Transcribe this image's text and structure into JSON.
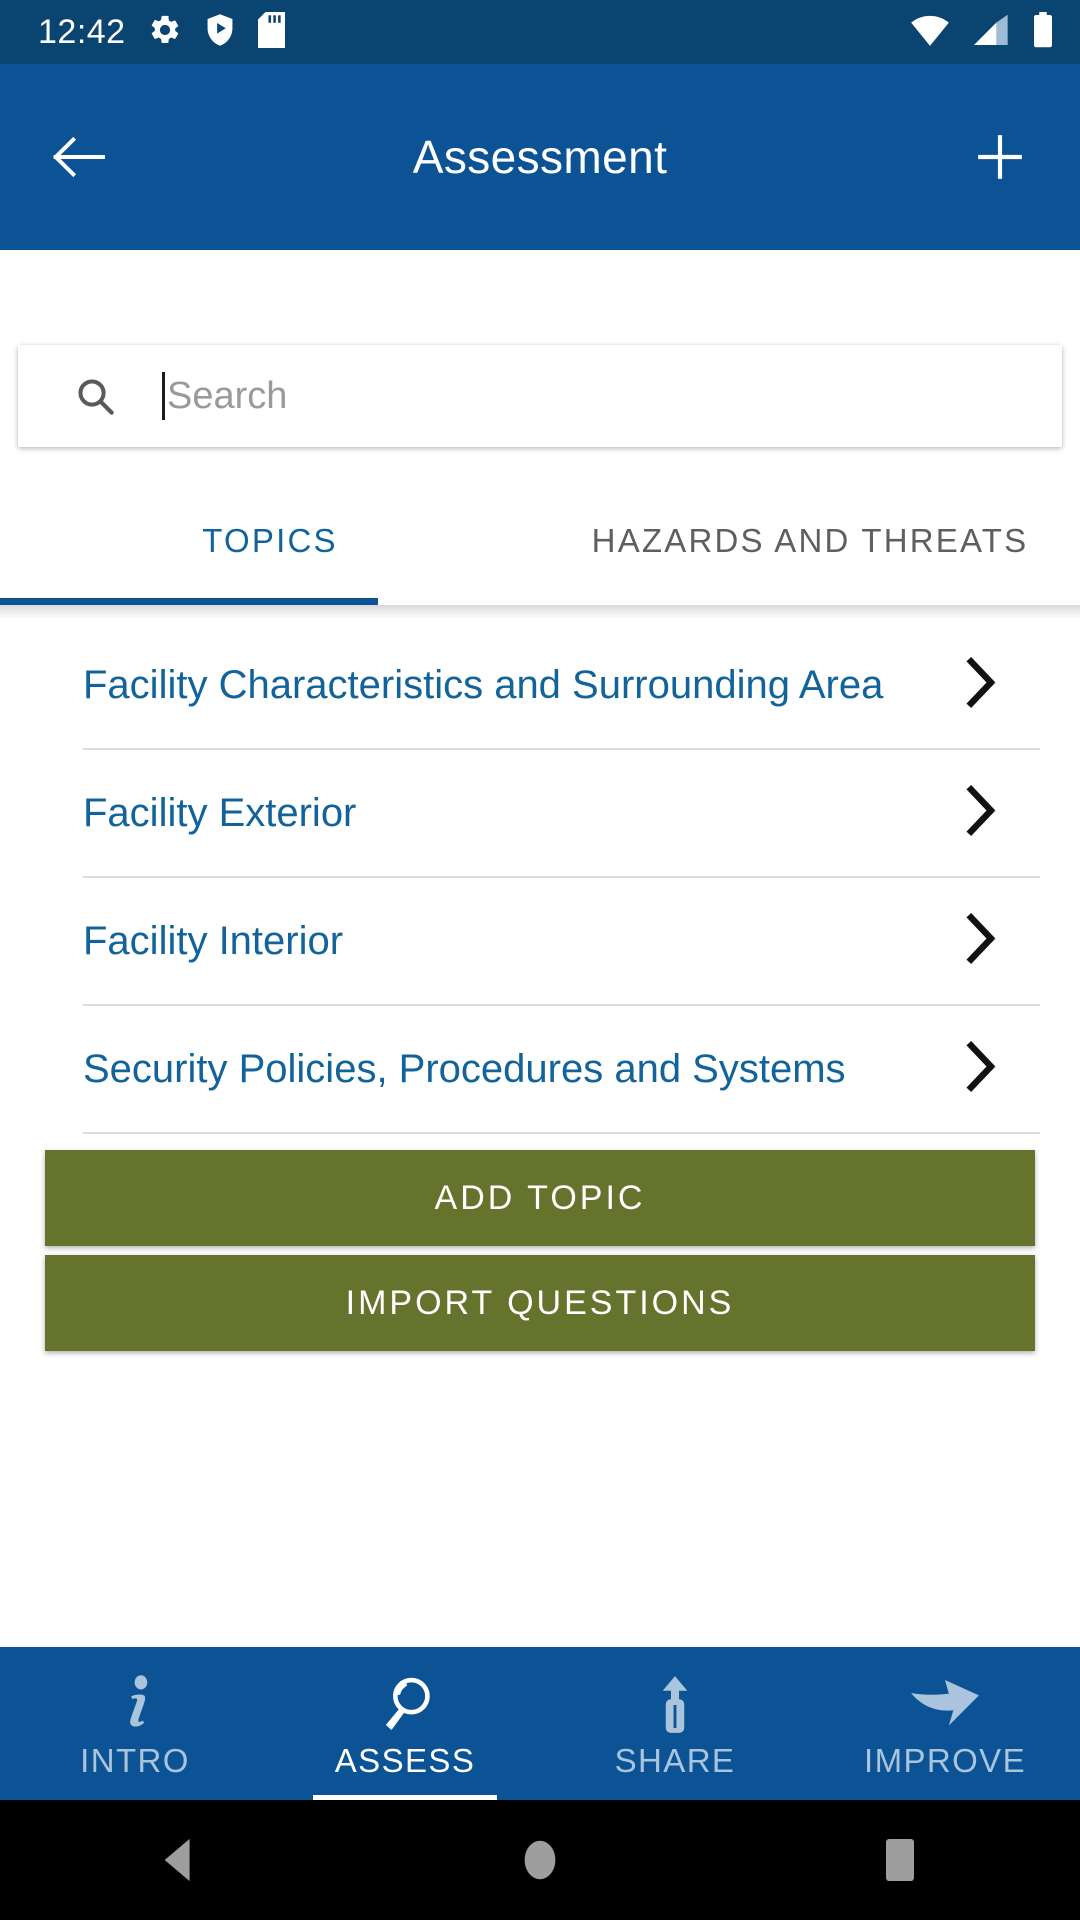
{
  "status_bar": {
    "time": "12:42",
    "left_icons": [
      "gear-icon",
      "play-protect-shield-icon",
      "sd-card-icon"
    ],
    "right_icons": [
      "wifi-icon",
      "cellular-signal-icon",
      "battery-icon"
    ],
    "background_color": "#0a4470"
  },
  "app_bar": {
    "title": "Assessment",
    "back_icon": "arrow-left-icon",
    "add_icon": "plus-icon",
    "background_color": "#0b5394"
  },
  "search": {
    "icon": "search-icon",
    "placeholder": "Search",
    "value": ""
  },
  "tabs": {
    "items": [
      {
        "label": "TOPICS",
        "active": true
      },
      {
        "label": "HAZARDS AND THREATS",
        "active": false
      }
    ],
    "active_color": "#13639b",
    "inactive_color": "#5f5f5f",
    "indicator_color": "#0b5394"
  },
  "topics": {
    "rows": [
      {
        "label": "Facility Characteristics and Surrounding Area",
        "chevron": "chevron-right-icon"
      },
      {
        "label": "Facility Exterior",
        "chevron": "chevron-right-icon"
      },
      {
        "label": "Facility Interior",
        "chevron": "chevron-right-icon"
      },
      {
        "label": "Security Policies, Procedures and Systems",
        "chevron": "chevron-right-icon"
      }
    ],
    "link_color": "#13639b"
  },
  "actions": {
    "add_topic_label": "ADD TOPIC",
    "import_questions_label": "IMPORT QUESTIONS",
    "button_color": "#66732c"
  },
  "bottom_nav": {
    "items": [
      {
        "label": "INTRO",
        "icon": "info-italic-icon",
        "active": false
      },
      {
        "label": "ASSESS",
        "icon": "magnifier-icon",
        "active": true
      },
      {
        "label": "SHARE",
        "icon": "share-upload-icon",
        "active": false
      },
      {
        "label": "IMPROVE",
        "icon": "curved-arrow-icon",
        "active": false
      }
    ],
    "background_color": "#0b5394",
    "active_color": "#ffffff",
    "inactive_color": "#a9c4dc"
  },
  "system_nav": {
    "buttons": [
      {
        "name": "back-triangle-icon"
      },
      {
        "name": "home-circle-icon"
      },
      {
        "name": "recents-square-icon"
      }
    ],
    "background_color": "#000000",
    "icon_color": "#9e9e9e"
  }
}
